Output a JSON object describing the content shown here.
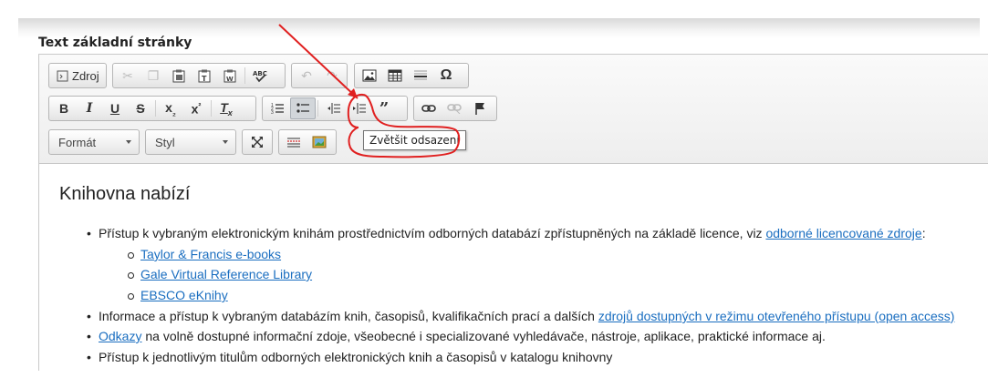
{
  "field_label": "Text základní stránky",
  "toolbar": {
    "source_label": "Zdroj",
    "spellcheck_label": "ABC",
    "format_combo": "Formát",
    "style_combo": "Styl",
    "tooltip": "Zvětšit odsazení",
    "icons": {
      "source": "source-icon",
      "cut": "cut-icon",
      "copy": "copy-icon",
      "paste": "paste-icon",
      "paste_text": "paste-text-icon",
      "paste_word": "paste-word-icon",
      "spellcheck": "spellcheck-icon",
      "undo": "undo-icon",
      "redo": "redo-icon",
      "image": "image-icon",
      "table": "table-icon",
      "hline": "horizontal-line-icon",
      "special_char": "omega-icon",
      "bold": "bold-icon",
      "italic": "italic-icon",
      "underline": "underline-icon",
      "strike": "strikethrough-icon",
      "subscript": "subscript-icon",
      "superscript": "superscript-icon",
      "remove_format": "remove-format-icon",
      "ordered_list": "numbered-list-icon",
      "bullet_list": "bulleted-list-icon",
      "outdent": "outdent-icon",
      "indent": "indent-icon",
      "blockquote": "blockquote-icon",
      "link": "link-icon",
      "unlink": "unlink-icon",
      "anchor": "anchor-flag-icon",
      "maximize": "maximize-icon",
      "show_blocks": "show-blocks-icon",
      "insert_media": "insert-media-icon"
    }
  },
  "content": {
    "heading": "Knihovna nabízí",
    "items": [
      {
        "text_before": "Přístup k vybraným elektronickým knihám prostřednictvím odborných databází zpřístupněných na základě licence, viz ",
        "link": "odborné licencované zdroje",
        "text_after": ":"
      },
      {
        "link": "Taylor & Francis e-books"
      },
      {
        "link": "Gale Virtual Reference Library"
      },
      {
        "link": "EBSCO eKnihy"
      },
      {
        "text_before": "Informace a přístup k vybraným databázím knih, časopisů, kvalifikačních prací a dalších ",
        "link": "zdrojů dostupných v režimu otevřeného přístupu (open access)",
        "text_after": ""
      },
      {
        "text_before": "",
        "link": "Odkazy",
        "text_after": " na volně dostupné informační zdoje, všeobecné i specializované vyhledávače, nástroje, aplikace, praktické informace aj."
      },
      {
        "text_before": "Přístup k jednotlivým titulům odborných elektronických knih a časopisů v katalogu knihovny",
        "text_after": ""
      }
    ]
  },
  "annotation_color": "#e02020"
}
